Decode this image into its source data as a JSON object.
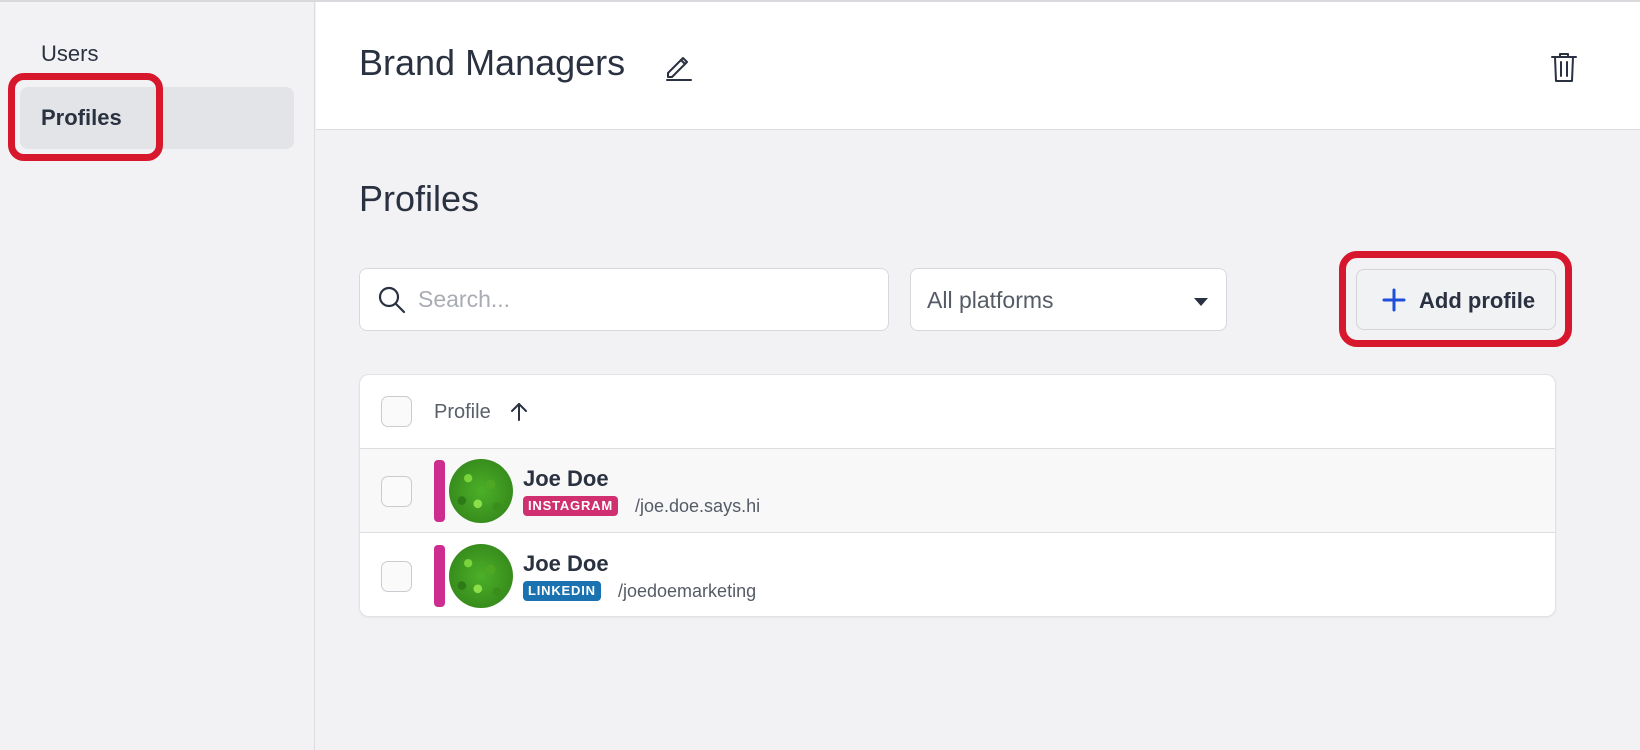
{
  "sidebar": {
    "items": [
      {
        "label": "Users"
      },
      {
        "label": "Profiles"
      }
    ]
  },
  "header": {
    "title": "Brand Managers"
  },
  "main": {
    "section_title": "Profiles",
    "search": {
      "placeholder": "Search...",
      "value": ""
    },
    "platform_filter": {
      "selected": "All platforms"
    },
    "add_button_label": "Add profile"
  },
  "table": {
    "column_header": "Profile",
    "rows": [
      {
        "name": "Joe Doe",
        "platform": "INSTAGRAM",
        "handle": "/joe.doe.says.hi",
        "platform_color": "#d0306f"
      },
      {
        "name": "Joe Doe",
        "platform": "LINKEDIN",
        "handle": "/joedoemarketing",
        "platform_color": "#1a73b0"
      }
    ]
  },
  "colors": {
    "highlight": "#d7172b",
    "profile_bar": "#cc2d8e",
    "accent_plus": "#1f4fd8"
  }
}
